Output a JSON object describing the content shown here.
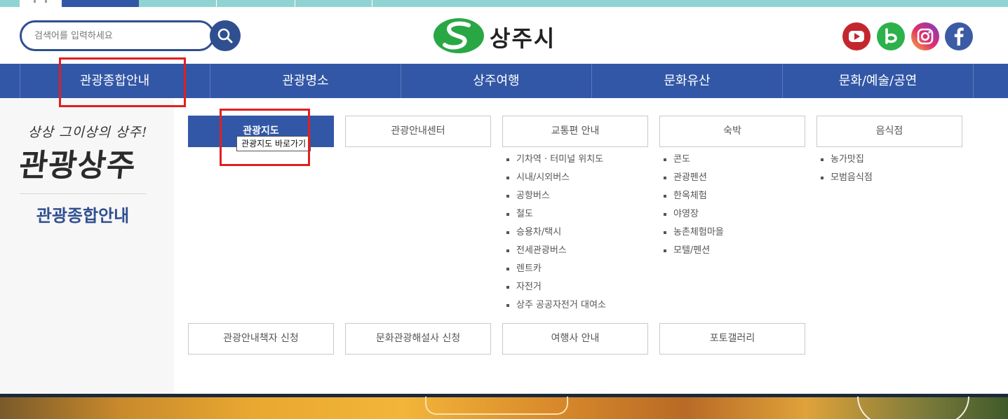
{
  "header": {
    "search_placeholder": "검색어를 입력하세요",
    "logo_text": "상주시"
  },
  "sns": [
    "youtube-icon",
    "blog-icon",
    "instagram-icon",
    "facebook-icon"
  ],
  "colors": {
    "nav": "#3257a6",
    "accent_green": "#2aa745",
    "search_border": "#2f4f8f",
    "annotation_red": "#e02020"
  },
  "gnb": {
    "items": [
      "관광종합안내",
      "관광명소",
      "상주여행",
      "문화유산",
      "문화/예술/공연"
    ]
  },
  "left": {
    "slogan": "상상 그이상의 상주!",
    "brand": "관광상주",
    "title": "관광종합안내"
  },
  "submenu": {
    "row1": [
      "관광지도",
      "관광안내센터",
      "교통편 안내",
      "숙박",
      "음식점"
    ],
    "row2": [
      "관광안내책자 신청",
      "문화관광해설사 신청",
      "여행사 안내",
      "포토갤러리"
    ],
    "tooltip": "관광지도 바로가기",
    "traffic": [
      "기차역 · 터미널 위치도",
      "시내/시외버스",
      "공항버스",
      "철도",
      "승용차/택시",
      "전세관광버스",
      "렌트카",
      "자전거",
      "상주 공공자전거 대여소"
    ],
    "lodging": [
      "콘도",
      "관광펜션",
      "한옥체험",
      "야영장",
      "농촌체험마을",
      "모텔/펜션"
    ],
    "food": [
      "농가맛집",
      "모범음식점"
    ]
  }
}
